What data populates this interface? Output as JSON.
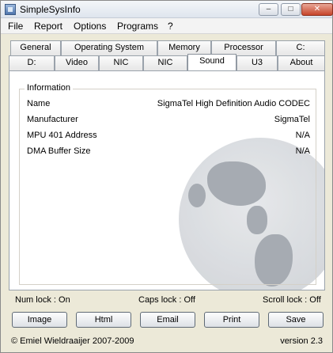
{
  "window": {
    "title": "SimpleSysInfo"
  },
  "menu": [
    "File",
    "Report",
    "Options",
    "Programs",
    "?"
  ],
  "tabs_row_back": [
    "General",
    "Operating System",
    "Memory",
    "Processor",
    "C:"
  ],
  "tabs_row_front": [
    "D:",
    "Video",
    "NIC",
    "NIC",
    "Sound",
    "U3",
    "About"
  ],
  "active_tab": "Sound",
  "info": {
    "legend": "Information",
    "rows": [
      {
        "label": "Name",
        "value": "SigmaTel High Definition Audio CODEC"
      },
      {
        "label": "Manufacturer",
        "value": "SigmaTel"
      },
      {
        "label": "MPU 401 Address",
        "value": "N/A"
      },
      {
        "label": "DMA Buffer Size",
        "value": "N/A"
      }
    ]
  },
  "status": {
    "num_lock": "Num lock : On",
    "caps_lock": "Caps lock : Off",
    "scroll_lock": "Scroll lock : Off"
  },
  "buttons": [
    "Image",
    "Html",
    "Email",
    "Print",
    "Save"
  ],
  "footer": {
    "copyright": "© Emiel Wieldraaijer 2007-2009",
    "version": "version 2.3"
  }
}
